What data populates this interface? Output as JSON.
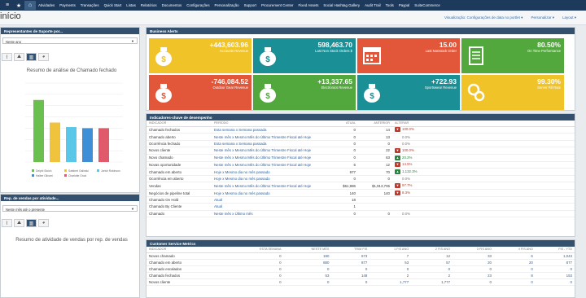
{
  "nav": {
    "items": [
      "Atividades",
      "Payments",
      "Transações",
      "Quick Start",
      "Listas",
      "Relatórios",
      "Documentos",
      "Configurações",
      "Personalização",
      "Support",
      "Procurement Center",
      "Fixed Assets",
      "Social Hashtag Gallery",
      "Audit Trail",
      "Tools",
      "Paypal",
      "SuiteCommerce"
    ]
  },
  "header": {
    "title": "início",
    "view_link": "Visualização: Configurações de data no portlet",
    "personalize_link": "Personalizar",
    "layout_link": "Layout"
  },
  "left_top": {
    "title": "Representantes de Suporte por...",
    "select_value": "Neste ano",
    "chart_title": "Resumo de análise de Chamado fechado",
    "legend": [
      "Delphi Stoich",
      "Salsbert Galinski",
      "Jorish Robinson",
      "Hailee Gilvarri",
      "Charlotte Grozl"
    ],
    "colors": [
      "#6bbf4e",
      "#f0c33c",
      "#59c7e8",
      "#3e8fd6",
      "#e05a6c"
    ]
  },
  "left_bottom": {
    "title": "Rep. de vendas por atividade...",
    "select_value": "Neste mês até o presente",
    "chart_title": "Resumo de atividade de vendas por rep. de vendas"
  },
  "chart_data": {
    "type": "bar",
    "categories": [
      "Delphi Stoich",
      "Salsbert Galinski",
      "Jorish Robinson",
      "Hailee Gilvarri",
      "Charlotte Grozl"
    ],
    "values": [
      11,
      7,
      6.2,
      6,
      6
    ],
    "ylim": [
      0,
      14
    ]
  },
  "alerts": {
    "title": "Business Alerts",
    "tiles": [
      {
        "value": "+443,603.96",
        "label": "Accounts Revenue",
        "color": "#f0c328",
        "icon": "money-bag-icon"
      },
      {
        "value": "598,463.70",
        "label": "Last Non Stock Orders $",
        "color": "#1a8f96",
        "icon": "money-bag-icon"
      },
      {
        "value": "15.00",
        "label": "Last Nonstock Order",
        "color": "#e2563a",
        "icon": "calendar-icon"
      },
      {
        "value": "80.50%",
        "label": "On Time Performance",
        "color": "#52a83c",
        "icon": "clipboard-icon"
      },
      {
        "value": "-746,084.52",
        "label": "Outdoor Gear Revenue",
        "color": "#e2563a",
        "icon": "money-bag-icon"
      },
      {
        "value": "+13,337.65",
        "label": "Electronics Revenue",
        "color": "#52a83c",
        "icon": "money-bag-icon"
      },
      {
        "value": "+722.93",
        "label": "Sportswear Revenue",
        "color": "#1a8f96",
        "icon": "money-bag-icon"
      },
      {
        "value": "99.30%",
        "label": "Server Fill Rate",
        "color": "#f0c328",
        "icon": "gears-icon"
      }
    ]
  },
  "kpi": {
    "title": "Indicadores-chave de desempenho",
    "headers": [
      "INDICADOR",
      "PERÍODO",
      "ATUAL",
      "ANTERIOR",
      "ALTERAR"
    ],
    "rows": [
      {
        "indicator": "Chamado fechados",
        "period": "Esta semana x Semana passada",
        "current": "0",
        "previous": "14",
        "alert": "down",
        "change": "100.0%"
      },
      {
        "indicator": "Chamado aberto",
        "period": "Neste mês x Mesmo Mês do Último Trimestre Fiscal até Hoje",
        "current": "0",
        "previous": "13",
        "alert": "",
        "change": "0.0%"
      },
      {
        "indicator": "Ocorrência fechado",
        "period": "Esta semana x Semana passada",
        "current": "0",
        "previous": "0",
        "alert": "",
        "change": "0.0%"
      },
      {
        "indicator": "Novos cliente",
        "period": "Neste mês x Mesmo Mês do Último Trimestre Fiscal até Hoje",
        "current": "0",
        "previous": "22",
        "alert": "down",
        "change": "100.0%"
      },
      {
        "indicator": "Novo chamado",
        "period": "Neste mês x Mesmo Mês do Último Trimestre Fiscal até Hoje",
        "current": "0",
        "previous": "63",
        "alert": "up",
        "change": "20.2%"
      },
      {
        "indicator": "Novas oportunidade",
        "period": "Neste mês x Mesmo Mês do Último Trimestre Fiscal até Hoje",
        "current": "6",
        "previous": "12",
        "alert": "down",
        "change": "14.5%"
      },
      {
        "indicator": "Chamado em aberto",
        "period": "Hoje x Mesmo dia no mês passado",
        "current": "977",
        "previous": "70",
        "alert": "up",
        "change": "1,132.3%"
      },
      {
        "indicator": "Ocorrência em aberto",
        "period": "Hoje x Mesmo dia no mês passado",
        "current": "0",
        "previous": "0",
        "alert": "",
        "change": "0.0%"
      },
      {
        "indicator": "Vendas",
        "period": "Neste mês x Mesmo Mês do Último Trimestre Fiscal até Hoje",
        "current": "$61,986",
        "previous": "$1,913,706",
        "alert": "down",
        "change": "97.7%"
      },
      {
        "indicator": "Negócios de pipeline total",
        "period": "Hoje x Mesmo dia no mês passado",
        "current": "140",
        "previous": "140",
        "alert": "down",
        "change": "8.3%"
      },
      {
        "indicator": "Chamado On Hold",
        "period": "Atual",
        "current": "18",
        "previous": "",
        "alert": "",
        "change": ""
      },
      {
        "indicator": "Chamado By Cliente",
        "period": "Atual",
        "current": "1",
        "previous": "",
        "alert": "",
        "change": ""
      },
      {
        "indicator": "Chamado",
        "period": "Neste mês x Último mês",
        "current": "0",
        "previous": "0",
        "alert": "",
        "change": "0.0%"
      }
    ]
  },
  "csm": {
    "title": "Customer Service Metrics",
    "headers": [
      "INDICADOR",
      "ESTA SEMANA",
      "NESTE MÊS",
      "TRIM FIS",
      "1 FIS ANO",
      "2 FIS ANO",
      "3 FIS ANO",
      "4 FIS ANO",
      "FIS - YTD"
    ],
    "rows": [
      [
        "Novos chamado",
        "0",
        "190",
        "673",
        "7",
        "12",
        "33",
        "6",
        "1,043"
      ],
      [
        "Chamado em aberto",
        "0",
        "880",
        "877",
        "53",
        "57",
        "20",
        "20",
        "877"
      ],
      [
        "Chamado escalados",
        "0",
        "0",
        "0",
        "0",
        "0",
        "0",
        "0",
        "0"
      ],
      [
        "Chamado fechados",
        "0",
        "53",
        "148",
        "2",
        "2",
        "23",
        "8",
        "153"
      ],
      [
        "Novos cliente",
        "0",
        "0",
        "0",
        "1,777",
        "1,777",
        "0",
        "0",
        "0"
      ]
    ]
  }
}
